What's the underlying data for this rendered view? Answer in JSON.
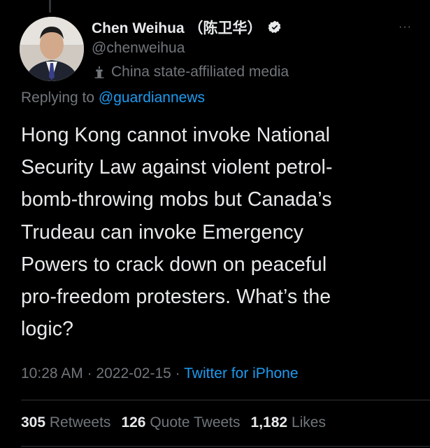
{
  "author": {
    "display_name": "Chen Weihua （陈卫华）",
    "handle": "@chenweihua",
    "label": "China state-affiliated media",
    "verified_icon": "verified-badge-icon",
    "label_icon": "podium-icon"
  },
  "reply": {
    "prefix": "Replying to",
    "mention": "@guardiannews"
  },
  "tweet": {
    "lines": [
      "Hong Kong cannot invoke National",
      "Security Law against violent petrol-",
      "bomb-throwing mobs but Canada’s",
      "Trudeau can invoke Emergency",
      "Powers to crack down on peaceful",
      "pro-freedom protesters. What’s the",
      "logic?"
    ]
  },
  "meta": {
    "time": "10:28 AM",
    "separator": " · ",
    "date": "2022-02-15",
    "source": "Twitter for iPhone"
  },
  "stats": {
    "retweets_count": "305",
    "retweets_label": "Retweets",
    "quotes_count": "126",
    "quotes_label": "Quote Tweets",
    "likes_count": "1,182",
    "likes_label": "Likes"
  },
  "colors": {
    "background": "#000000",
    "text": "#e7e9ea",
    "secondary": "#71767b",
    "link": "#1d9bf0"
  }
}
